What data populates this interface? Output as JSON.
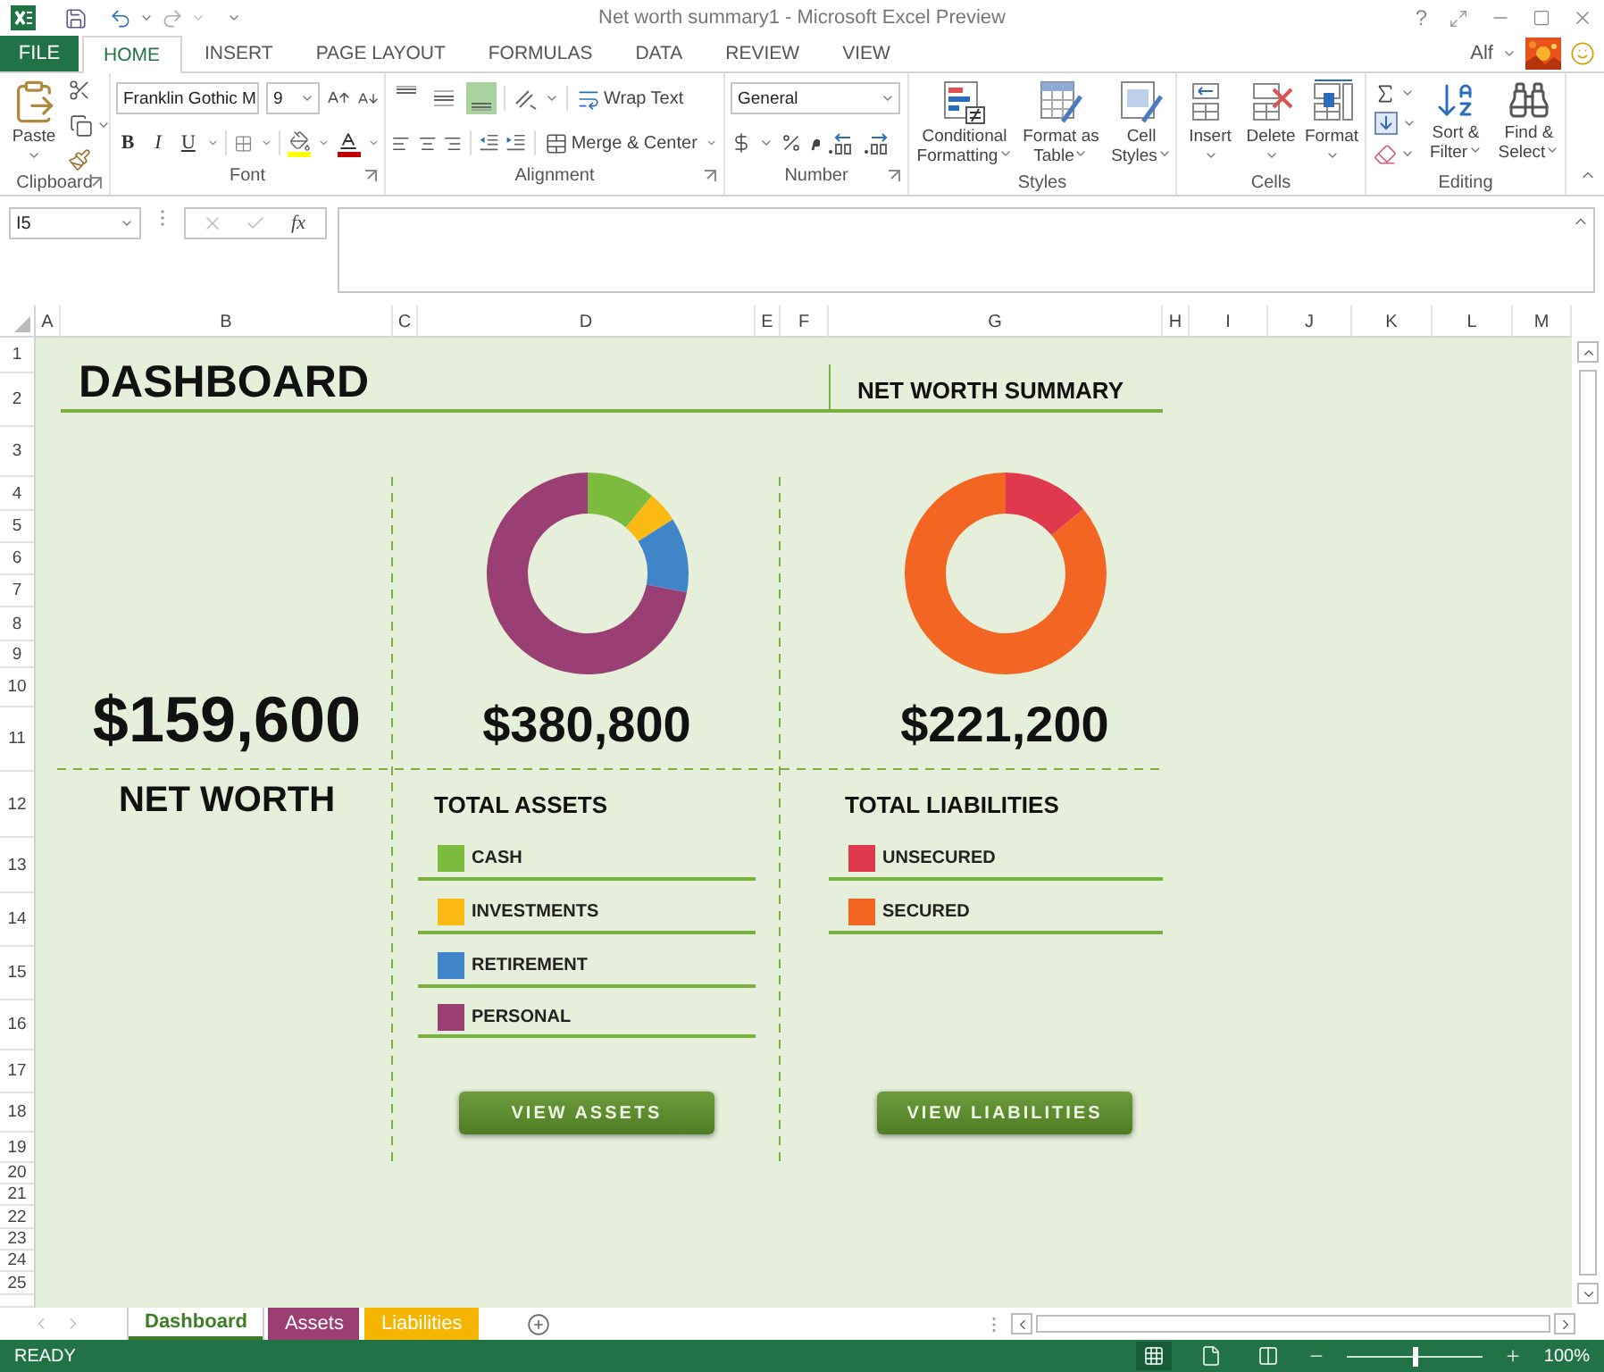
{
  "window": {
    "title": "Net worth summary1 - Microsoft Excel Preview",
    "help": "?"
  },
  "ribbon_tabs": [
    {
      "label": "FILE",
      "kind": "file"
    },
    {
      "label": "HOME",
      "kind": "tab",
      "selected": true
    },
    {
      "label": "INSERT",
      "kind": "tab",
      "selected": false
    },
    {
      "label": "PAGE LAYOUT",
      "kind": "tab",
      "selected": false
    },
    {
      "label": "FORMULAS",
      "kind": "tab",
      "selected": false
    },
    {
      "label": "DATA",
      "kind": "tab",
      "selected": false
    },
    {
      "label": "REVIEW",
      "kind": "tab",
      "selected": false
    },
    {
      "label": "VIEW",
      "kind": "tab",
      "selected": false
    }
  ],
  "user": {
    "name": "Alf"
  },
  "ribbon": {
    "clipboard": {
      "label": "Clipboard",
      "paste": "Paste"
    },
    "font": {
      "label": "Font",
      "name": "Franklin Gothic M",
      "size": "9",
      "bold": "B",
      "italic": "I",
      "underline": "U"
    },
    "alignment": {
      "label": "Alignment",
      "vertical": [
        {
          "selected": false
        },
        {
          "selected": false
        },
        {
          "selected": true
        }
      ],
      "wrap_text": "Wrap Text",
      "merge": "Merge & Center"
    },
    "number": {
      "label": "Number",
      "format": "General"
    },
    "styles": {
      "label": "Styles",
      "buttons": [
        "Conditional Formatting",
        "Format as Table",
        "Cell Styles"
      ]
    },
    "cells": {
      "label": "Cells",
      "buttons": [
        "Insert",
        "Delete",
        "Format"
      ]
    },
    "editing": {
      "label": "Editing",
      "sort": "Sort & Filter",
      "find": "Find & Select"
    }
  },
  "formula_bar": {
    "name_box": "I5",
    "fx": "fx"
  },
  "columns": [
    "A",
    "B",
    "C",
    "D",
    "E",
    "F",
    "G",
    "H",
    "I",
    "J",
    "K",
    "L",
    "M"
  ],
  "rows": [
    "1",
    "2",
    "3",
    "4",
    "5",
    "6",
    "7",
    "8",
    "9",
    "10",
    "11",
    "12",
    "13",
    "14",
    "15",
    "16",
    "17",
    "18",
    "19",
    "20",
    "21",
    "22",
    "23",
    "24",
    "25"
  ],
  "dashboard": {
    "title": "DASHBOARD",
    "summary_title": "NET WORTH SUMMARY",
    "net_worth": {
      "value": "$159,600",
      "label": "NET WORTH"
    },
    "assets": {
      "total": "$380,800",
      "title": "TOTAL ASSETS",
      "button": "VIEW ASSETS",
      "items": [
        {
          "label": "CASH",
          "color": "#7cbb3d"
        },
        {
          "label": "INVESTMENTS",
          "color": "#fbb914"
        },
        {
          "label": "RETIREMENT",
          "color": "#3f85c8"
        },
        {
          "label": "PERSONAL",
          "color": "#9a3f73"
        }
      ]
    },
    "liabilities": {
      "total": "$221,200",
      "title": "TOTAL LIABILITIES",
      "button": "VIEW LIABILITIES",
      "items": [
        {
          "label": "UNSECURED",
          "color": "#e0394e"
        },
        {
          "label": "SECURED",
          "color": "#f26522"
        }
      ]
    }
  },
  "sheet_tabs": [
    {
      "label": "Dashboard",
      "selected": true,
      "color": "#3a7d22"
    },
    {
      "label": "Assets",
      "selected": false,
      "color": "#9b3f73"
    },
    {
      "label": "Liabilities",
      "selected": false,
      "color": "#f5b400"
    }
  ],
  "status_bar": {
    "text": "READY",
    "zoom": {
      "level": 0.5,
      "reading": "100%"
    }
  }
}
